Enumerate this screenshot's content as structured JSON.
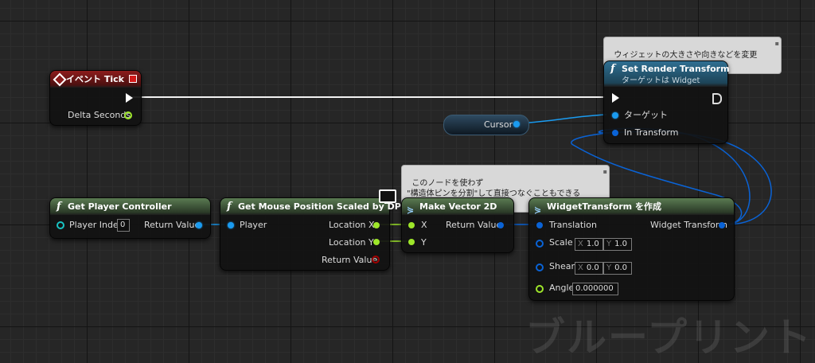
{
  "canvas": {
    "watermark": "ブループリント"
  },
  "tooltip_render": {
    "text": "ウィジェットの大きさや向きなどを変更",
    "close": "▪"
  },
  "tooltip_note": {
    "text": "このノードを使わず\n\"構造体ピンを分割\"して直接つなぐこともできる",
    "close": "▪"
  },
  "event_tick": {
    "title": "イベント Tick",
    "delta_seconds": "Delta Seconds"
  },
  "set_render_transform": {
    "title": "Set Render Transform",
    "subtitle": "ターゲットは Widget",
    "target": "ターゲット",
    "in_transform": "In Transform"
  },
  "cursor_var": {
    "label": "Cursor"
  },
  "get_player_controller": {
    "title": "Get Player Controller",
    "player_index": "Player Index",
    "player_index_value": "0",
    "return_value": "Return Value"
  },
  "get_mouse_position": {
    "title": "Get Mouse Position Scaled by DPI",
    "player": "Player",
    "location_x": "Location X",
    "location_y": "Location Y",
    "return_value": "Return Value"
  },
  "make_vector": {
    "title": "Make Vector 2D",
    "x": "X",
    "y": "Y",
    "return_value": "Return Value"
  },
  "widget_transform": {
    "title": "WidgetTransform を作成",
    "translation": "Translation",
    "widget_transform": "Widget Transform",
    "scale": "Scale",
    "scale_x": "1.0",
    "scale_y": "1.0",
    "shear": "Shear",
    "shear_x": "0.0",
    "shear_y": "0.0",
    "angle": "Angle",
    "angle_value": "0.000000",
    "x_label": "X",
    "y_label": "Y"
  },
  "colors": {
    "exec": "#ffffff",
    "object_pin": "#1a9bf0",
    "struct_pin": "#0a63d6",
    "float_pin": "#9ee62a",
    "bool_pin": "#a00000"
  }
}
